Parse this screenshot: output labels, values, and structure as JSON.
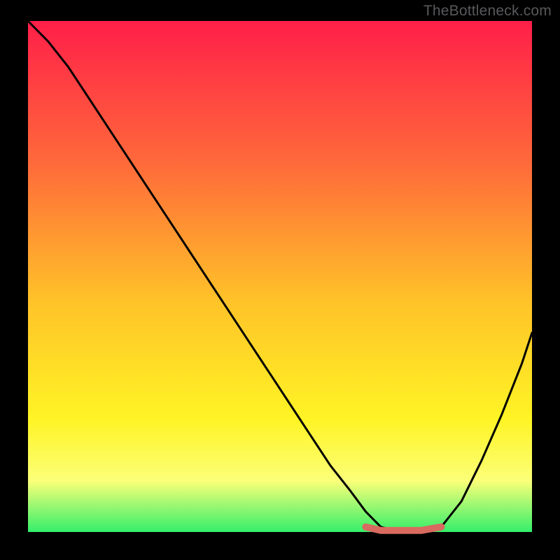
{
  "watermark": "TheBottleneck.com",
  "colors": {
    "gradient_top": "#ff1f49",
    "gradient_mid1": "#ff6a3a",
    "gradient_mid2": "#ffc328",
    "gradient_mid3": "#fff425",
    "gradient_mid4": "#fbff78",
    "gradient_bot": "#34ef6a",
    "curve": "#000000",
    "marker": "#d96a5f"
  },
  "chart_data": {
    "type": "line",
    "title": "",
    "xlabel": "",
    "ylabel": "",
    "xlim": [
      0,
      100
    ],
    "ylim": [
      0,
      100
    ],
    "grid": false,
    "legend": false,
    "annotations": [],
    "series": [
      {
        "name": "bottleneck-curve",
        "x": [
          0,
          4,
          8,
          12,
          16,
          20,
          24,
          28,
          32,
          36,
          40,
          44,
          48,
          52,
          56,
          60,
          64,
          67,
          70,
          74,
          78,
          82,
          86,
          90,
          94,
          98,
          100
        ],
        "y": [
          100,
          96,
          91,
          85,
          79,
          73,
          67,
          61,
          55,
          49,
          43,
          37,
          31,
          25,
          19,
          13,
          8,
          4,
          1,
          0,
          0,
          1,
          6,
          14,
          23,
          33,
          39
        ]
      },
      {
        "name": "optimal-range-marker",
        "x": [
          67,
          70,
          74,
          78,
          82
        ],
        "y": [
          1.0,
          0.3,
          0.3,
          0.3,
          1.0
        ]
      }
    ]
  }
}
